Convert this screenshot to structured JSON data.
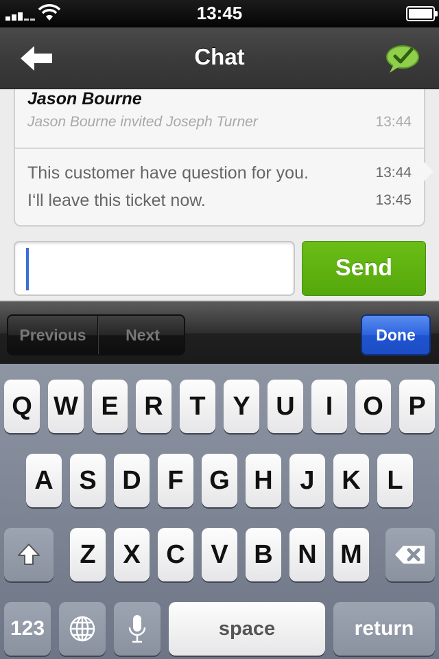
{
  "status_bar": {
    "time": "13:45",
    "signal_icon": "cellular-signal-icon",
    "wifi_icon": "wifi-icon",
    "battery_icon": "battery-icon"
  },
  "nav": {
    "title": "Chat",
    "back_icon": "back-arrow-icon",
    "action_icon": "chat-check-icon"
  },
  "chat": {
    "header_sender": "Jason Bourne",
    "system_message": {
      "text": "Jason Bourne invited Joseph Turner",
      "time": "13:44"
    },
    "messages": [
      {
        "text": "This customer have question for you.",
        "time": "13:44"
      },
      {
        "text": "I‘ll leave this ticket now.",
        "time": "13:45"
      }
    ],
    "input_value": "",
    "send_label": "Send"
  },
  "accessory": {
    "previous_label": "Previous",
    "next_label": "Next",
    "done_label": "Done"
  },
  "keyboard": {
    "row1": [
      "Q",
      "W",
      "E",
      "R",
      "T",
      "Y",
      "U",
      "I",
      "O",
      "P"
    ],
    "row2": [
      "A",
      "S",
      "D",
      "F",
      "G",
      "H",
      "J",
      "K",
      "L"
    ],
    "row3": [
      "Z",
      "X",
      "C",
      "V",
      "B",
      "N",
      "M"
    ],
    "numbers_label": "123",
    "space_label": "space",
    "return_label": "return",
    "shift_icon": "shift-icon",
    "delete_icon": "delete-icon",
    "globe_icon": "globe-icon",
    "mic_icon": "microphone-icon"
  },
  "colors": {
    "send_green": "#5cb311",
    "done_blue": "#2d64de",
    "caret_blue": "#3c6ed8",
    "nav_dark": "#3a3a3a"
  }
}
